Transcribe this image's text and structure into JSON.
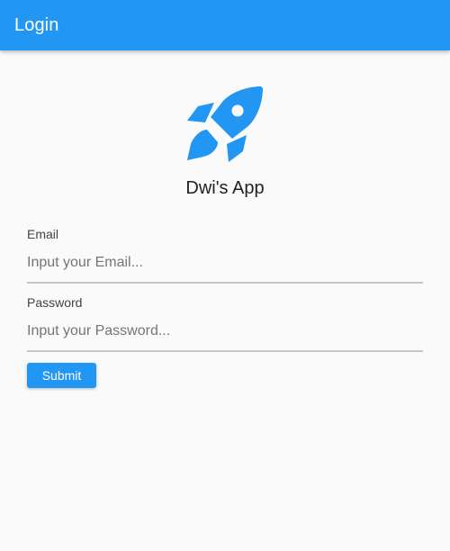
{
  "app_bar": {
    "title": "Login",
    "color": "#2196f3"
  },
  "logo": {
    "icon": "rocket-icon",
    "color": "#2196f3"
  },
  "app_name": "Dwi's App",
  "form": {
    "email": {
      "label": "Email",
      "placeholder": "Input your Email...",
      "value": ""
    },
    "password": {
      "label": "Password",
      "placeholder": "Input your Password...",
      "value": ""
    },
    "submit_label": "Submit"
  }
}
